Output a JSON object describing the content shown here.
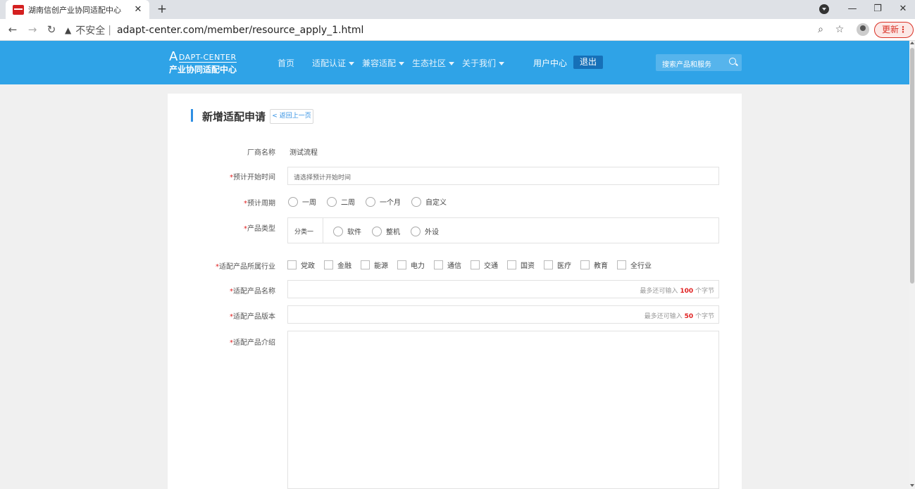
{
  "browser": {
    "tab_title": "湖南信创产业协同适配中心",
    "tab_close": "✕",
    "new_tab": "+",
    "insecure_label": "不安全",
    "separator": "|",
    "url": "adapt-center.com/member/resource_apply_1.html",
    "update_label": "更新",
    "update_menu": "⋮",
    "win_minimize": "—",
    "win_restore": "❐",
    "win_close": "✕"
  },
  "site": {
    "logo_line1_letter": "A",
    "logo_line1_rest": "DAPT-CENTER",
    "logo_line2": "产业协同适配中心",
    "nav": [
      {
        "label": "首页",
        "dropdown": false
      },
      {
        "label": "适配认证",
        "dropdown": true
      },
      {
        "label": "兼容适配",
        "dropdown": true
      },
      {
        "label": "生态社区",
        "dropdown": true
      },
      {
        "label": "关于我们",
        "dropdown": true
      }
    ],
    "user_center": "用户中心",
    "logout": "退出",
    "search_placeholder": "搜索产品和服务"
  },
  "form": {
    "title": "新增适配申请",
    "back_label": "< 返回上一页",
    "vendor_label": "厂商名称",
    "vendor_value": "测试流程",
    "start_time_label": "预计开始时间",
    "start_time_placeholder": "请选择预计开始时间",
    "period_label": "预计周期",
    "period_options": [
      "一周",
      "二周",
      "一个月",
      "自定义"
    ],
    "product_type_label": "产品类型",
    "product_type_category": "分类一",
    "product_type_options": [
      "软件",
      "整机",
      "外设"
    ],
    "industry_label": "适配产品所属行业",
    "industry_options": [
      "党政",
      "金融",
      "能源",
      "电力",
      "通信",
      "交通",
      "国资",
      "医疗",
      "教育",
      "全行业"
    ],
    "product_name_label": "适配产品名称",
    "product_name_limit_prefix": "最多还可输入",
    "product_name_limit_value": "100",
    "product_name_limit_suffix": "个字节",
    "product_version_label": "适配产品版本",
    "product_version_limit_prefix": "最多还可输入",
    "product_version_limit_value": "50",
    "product_version_limit_suffix": "个字节",
    "product_intro_label": "适配产品介绍",
    "required_mark": "*"
  },
  "colors": {
    "header_bg": "#2fa3e7",
    "accent": "#2f8fe3",
    "required": "#e02020"
  }
}
